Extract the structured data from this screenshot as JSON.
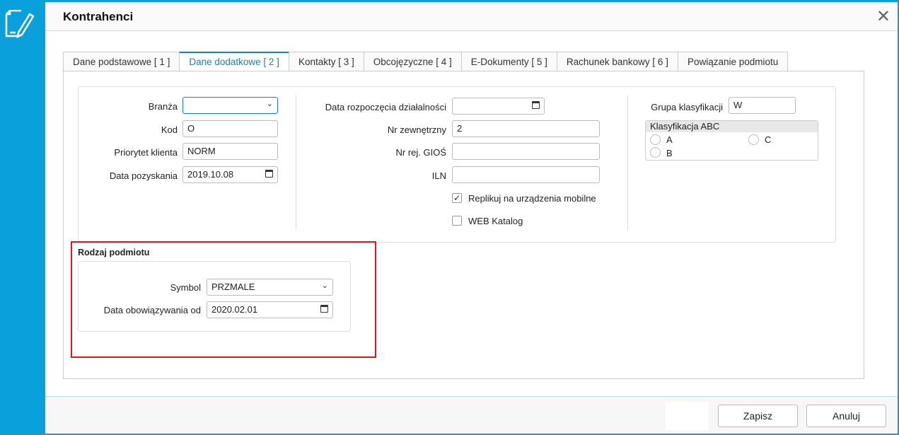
{
  "window": {
    "title": "Kontrahenci",
    "close_label": "✕"
  },
  "tabs": [
    {
      "label": "Dane podstawowe [ 1 ]"
    },
    {
      "label": "Dane dodatkowe [ 2 ]"
    },
    {
      "label": "Kontakty [ 3 ]"
    },
    {
      "label": "Obcojęzyczne [ 4 ]"
    },
    {
      "label": "E-Dokumenty [ 5 ]"
    },
    {
      "label": "Rachunek bankowy [ 6 ]"
    },
    {
      "label": "Powiązanie podmiotu"
    }
  ],
  "active_tab": 1,
  "col1": {
    "branza_label": "Branża",
    "branza_value": "",
    "kod_label": "Kod",
    "kod_value": "O",
    "priorytet_label": "Priorytet klienta",
    "priorytet_value": "NORM",
    "data_pozyskania_label": "Data pozyskania",
    "data_pozyskania_value": "2019.10.08"
  },
  "col2": {
    "data_rozp_label": "Data rozpoczęcia działalności",
    "data_rozp_value": "",
    "nr_zew_label": "Nr zewnętrzny",
    "nr_zew_value": "2",
    "gios_label": "Nr rej. GIOŚ",
    "gios_value": "",
    "iln_label": "ILN",
    "iln_value": "",
    "replikuj_label": "Replikuj na urządzenia mobilne",
    "replikuj_checked": true,
    "web_label": "WEB Katalog",
    "web_checked": false
  },
  "col3": {
    "grupa_label": "Grupa klasyfikacji",
    "grupa_value": "W",
    "abc_title": "Klasyfikacja ABC",
    "options": [
      "A",
      "B",
      "C"
    ]
  },
  "rodzaj": {
    "title": "Rodzaj podmiotu",
    "symbol_label": "Symbol",
    "symbol_value": "PRZMALE",
    "data_label": "Data obowiązywania od",
    "data_value": "2020.02.01"
  },
  "footer": {
    "save": "Zapisz",
    "cancel": "Anuluj"
  },
  "colors": {
    "accent": "#0aa0dc",
    "tab_active": "#1a7fc0",
    "highlight": "#e0161e"
  }
}
